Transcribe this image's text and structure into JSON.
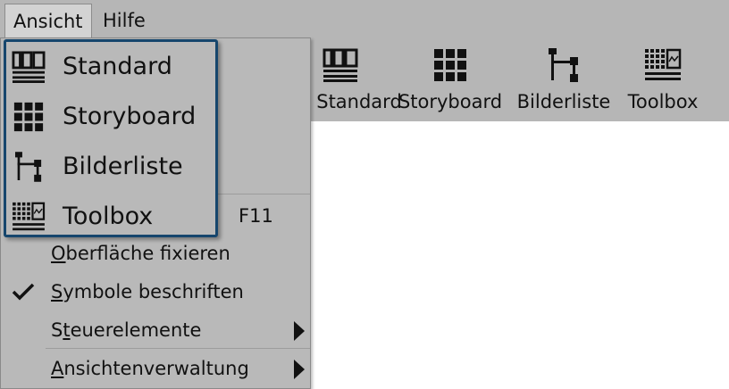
{
  "menubar": {
    "items": [
      {
        "label": "Ansicht",
        "active": true
      },
      {
        "label": "Hilfe",
        "active": false
      }
    ]
  },
  "toolbar": {
    "buttons": [
      {
        "label": "Standard",
        "icon": "standard-layout-icon"
      },
      {
        "label": "Storyboard",
        "icon": "storyboard-grid-icon"
      },
      {
        "label": "Bilderliste",
        "icon": "image-list-tree-icon"
      },
      {
        "label": "Toolbox",
        "icon": "toolbox-icon"
      }
    ]
  },
  "layouts_submenu": {
    "items": [
      {
        "label": "Standard",
        "icon": "standard-layout-icon"
      },
      {
        "label": "Storyboard",
        "icon": "storyboard-grid-icon"
      },
      {
        "label": "Bilderliste",
        "icon": "image-list-tree-icon"
      },
      {
        "label": "Toolbox",
        "icon": "toolbox-icon"
      }
    ],
    "border_color": "#16466d"
  },
  "view_menu": {
    "fullscreen_shortcut": "F11",
    "items": [
      {
        "label": "Oberfläche fixieren",
        "mnemonic": "O",
        "rest": "berfläche fixieren",
        "checked": false
      },
      {
        "label": "Symbole beschriften",
        "mnemonic": "S",
        "rest": "ymbole beschriften",
        "checked": true
      },
      {
        "label": "Steuerelemente",
        "pre": "S",
        "mnemonic": "t",
        "rest": "euerelemente",
        "checked": false,
        "has_submenu": true
      },
      {
        "label": "Ansichtenverwaltung",
        "mnemonic": "A",
        "rest": "nsichtenverwaltung",
        "checked": false,
        "has_submenu": true
      }
    ]
  }
}
